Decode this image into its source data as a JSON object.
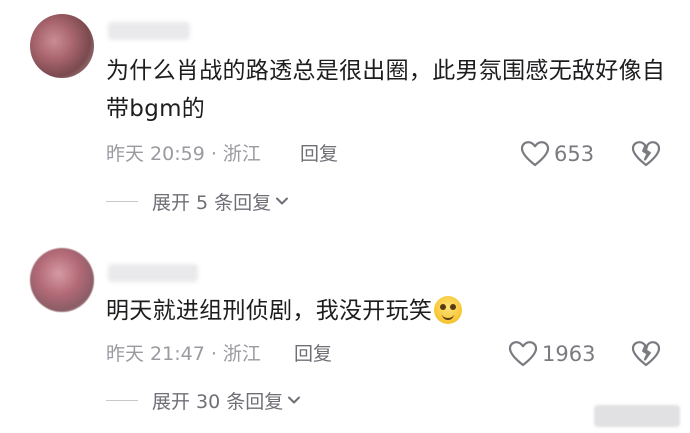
{
  "comments": [
    {
      "username": "",
      "text": "为什么肖战的路透总是很出圈，此男氛围感无敌好像自带bgm的",
      "meta": "昨天 20:59 · 浙江",
      "reply_label": "回复",
      "likes": "653",
      "expand_label": "展开 5 条回复"
    },
    {
      "username": "",
      "text": "明天就进组刑侦剧，我没开玩笑",
      "emoji": "smiling-face-emoji",
      "meta": "昨天 21:47 · 浙江",
      "reply_label": "回复",
      "likes": "1963",
      "expand_label": "展开 30 条回复"
    }
  ],
  "icons": {
    "like": "heart-outline-icon",
    "dislike": "broken-heart-icon",
    "expand": "chevron-down-icon"
  },
  "colors": {
    "text": "#1d1d1f",
    "meta": "#9a9aa0",
    "action": "#6f6f76"
  }
}
